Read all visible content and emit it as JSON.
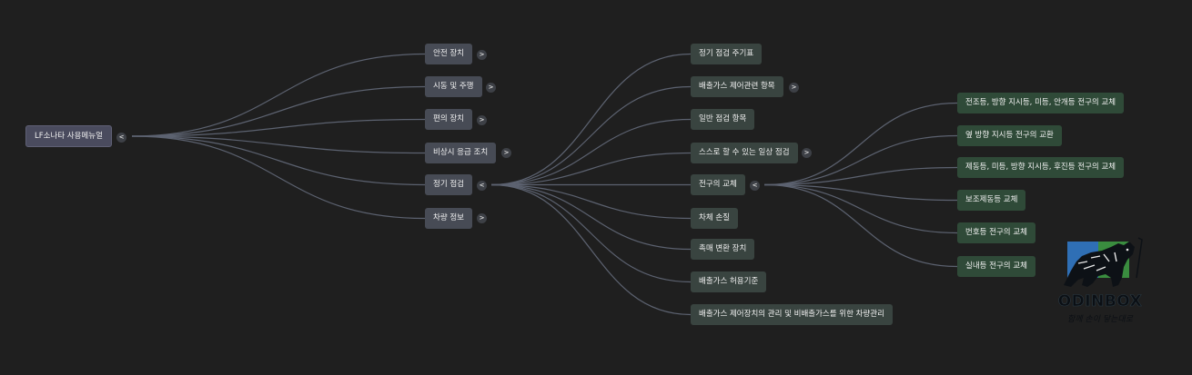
{
  "root": {
    "label": "LF소나타 사용메뉴얼",
    "toggle": "<"
  },
  "level1": [
    {
      "label": "안전 장치",
      "toggle": ">"
    },
    {
      "label": "시동 및 주행",
      "toggle": ">"
    },
    {
      "label": "편의 장치",
      "toggle": ">"
    },
    {
      "label": "비상시 응급 조치",
      "toggle": ">"
    },
    {
      "label": "정기 점검",
      "toggle": "<"
    },
    {
      "label": "차량 정보",
      "toggle": ">"
    }
  ],
  "level2": [
    {
      "label": "정기 점검 주기표",
      "toggle": ""
    },
    {
      "label": "배출가스 제어관련 항목",
      "toggle": ">"
    },
    {
      "label": "일반 점검 항목",
      "toggle": ""
    },
    {
      "label": "스스로 할 수 있는 일상 점검",
      "toggle": ">"
    },
    {
      "label": "전구의 교체",
      "toggle": "<"
    },
    {
      "label": "차체 손질",
      "toggle": ""
    },
    {
      "label": "촉매 변환 장치",
      "toggle": ""
    },
    {
      "label": "배출가스 허용기준",
      "toggle": ""
    },
    {
      "label": "배출가스 제어장치의 관리 및 비배출가스를 위한 차량관리",
      "toggle": ""
    }
  ],
  "level3": [
    {
      "label": "전조등, 방향 지시등, 미등, 안개등 전구의 교체"
    },
    {
      "label": "옆 방향 지시등 전구의 교환"
    },
    {
      "label": "제동등, 미등, 방향 지시등, 후진등 전구의 교체"
    },
    {
      "label": "보조제동등 교체"
    },
    {
      "label": "번호등 전구의 교체"
    },
    {
      "label": "실내등 전구의 교체"
    }
  ],
  "watermark": {
    "name": "ODINBOX",
    "tagline": "함께 손이 닿는대로",
    "icon": "tiger-logo-icon"
  },
  "colors": {
    "background": "#1f1f1f",
    "root": "#4a4b5e",
    "level1": "#474b55",
    "level2": "#394440",
    "level3": "#2f4a38",
    "link": "#5c6270"
  }
}
